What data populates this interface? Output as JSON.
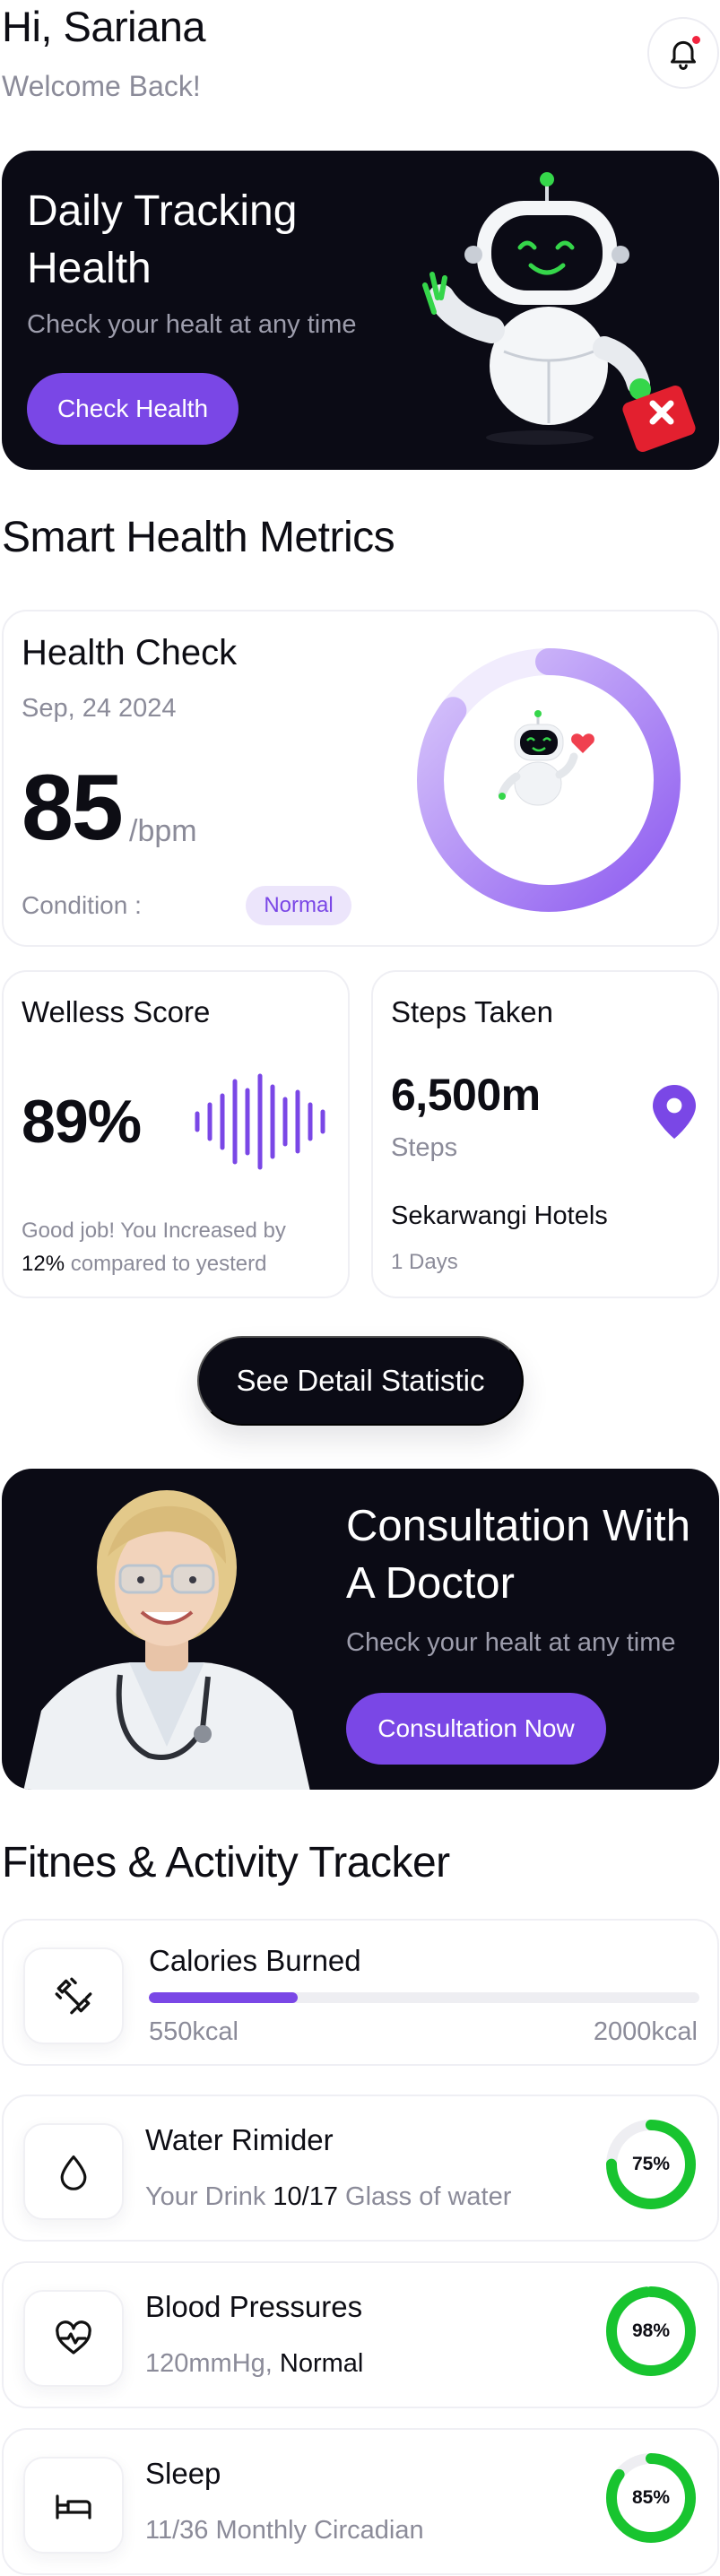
{
  "header": {
    "greeting": "Hi, Sariana",
    "subtitle": "Welcome Back!",
    "notification_icon": "bell-icon"
  },
  "hero": {
    "title": "Daily Tracking Health",
    "subtitle": "Check your healt at any time",
    "button": "Check Health",
    "illustration": "robot-with-first-aid-kit"
  },
  "metrics": {
    "section_title": "Smart Health Metrics",
    "health_check": {
      "title": "Health Check",
      "date": "Sep, 24 2024",
      "value": "85",
      "unit": "/bpm",
      "condition_label": "Condition :",
      "condition": "Normal",
      "gauge_percent": 85
    },
    "wellness": {
      "title": "Welless Score",
      "value": "89%",
      "note_prefix": "Good job! You Increased by",
      "note_highlight": "12%",
      "note_suffix": "compared to yesterd"
    },
    "steps": {
      "title": "Steps Taken",
      "value": "6,500m",
      "unit": "Steps",
      "place": "Sekarwangi Hotels",
      "duration": "1 Days",
      "icon": "location-pin-icon"
    },
    "detail_button": "See Detail Statistic"
  },
  "consultation": {
    "title": "Consultation With A Doctor",
    "subtitle": "Check your healt at any time",
    "button": "Consultation Now"
  },
  "tracker": {
    "section_title": "Fitnes & Activity Tracker",
    "calories": {
      "title": "Calories Burned",
      "current": "550kcal",
      "goal": "2000kcal",
      "fill_fraction": 0.27
    },
    "water": {
      "title": "Water Rimider",
      "sub_prefix": "Your Drink",
      "sub_value": "10/17",
      "sub_suffix": "Glass of water",
      "percent_label": "75%",
      "percent": 75
    },
    "blood": {
      "title": "Blood Pressures",
      "sub_prefix": "120mmHg,",
      "sub_value": "Normal",
      "percent_label": "98%",
      "percent": 98
    },
    "sleep": {
      "title": "Sleep",
      "sub_prefix": "11/36 Monthly Circadian",
      "percent_label": "85%",
      "percent": 85
    }
  },
  "colors": {
    "accent": "#7a47e6",
    "dark": "#0b0b15",
    "ring_green": "#18c42f",
    "robot_green": "#35d64a"
  }
}
